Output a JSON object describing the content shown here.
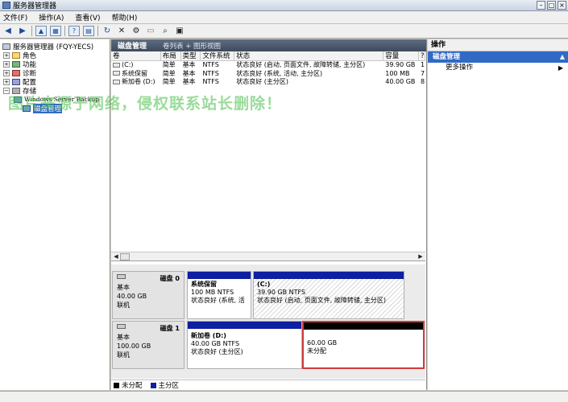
{
  "window": {
    "title": "服务器管理器",
    "controls": [
      "–",
      "□",
      "×"
    ]
  },
  "menu": {
    "items": [
      "文件(F)",
      "操作(A)",
      "查看(V)",
      "帮助(H)"
    ]
  },
  "toolbar": {
    "icons": [
      "back-icon",
      "forward-icon",
      "up-folder-icon",
      "show-tree-icon",
      "help-icon",
      "properties-icon",
      "refresh-icon",
      "delete-icon",
      "settings-icon",
      "open-icon",
      "search-icon",
      "view-icon"
    ]
  },
  "tree": {
    "root": "服务器管理器 (FQY-YECS)",
    "roles": "角色",
    "features": "功能",
    "diagnostics": "诊断",
    "configuration": "配置",
    "storage": "存储",
    "backup": "Windows Server Backup",
    "disk_mgmt": "磁盘管理"
  },
  "center": {
    "title": "磁盘管理",
    "view_links": "卷列表 + 图形视图",
    "columns": [
      "卷",
      "布局",
      "类型",
      "文件系统",
      "状态",
      "容量",
      "?"
    ],
    "rows": [
      [
        "(C:)",
        "简单",
        "基本",
        "NTFS",
        "状态良好 (启动, 页面文件, 故障转储, 主分区)",
        "39.90 GB",
        "1"
      ],
      [
        "系统保留",
        "简单",
        "基本",
        "NTFS",
        "状态良好 (系统, 活动, 主分区)",
        "100 MB",
        "7"
      ],
      [
        "新加卷 (D:)",
        "简单",
        "基本",
        "NTFS",
        "状态良好 (主分区)",
        "40.00 GB",
        "8"
      ]
    ],
    "disks": [
      {
        "name": "磁盘 0",
        "type": "基本",
        "size": "40.00 GB",
        "status": "联机",
        "partitions": [
          {
            "name": "系统保留",
            "size": "100 MB NTFS",
            "status": "状态良好 (系统, 活"
          },
          {
            "name": "(C:)",
            "size": "39.90 GB NTFS",
            "status": "状态良好 (启动, 页面文件, 故障转储, 主分区)"
          }
        ]
      },
      {
        "name": "磁盘 1",
        "type": "基本",
        "size": "100.00 GB",
        "status": "联机",
        "partitions": [
          {
            "name": "新加卷 (D:)",
            "size": "40.00 GB NTFS",
            "status": "状态良好 (主分区)"
          },
          {
            "name": "",
            "size": "60.00 GB",
            "status": "未分配"
          }
        ]
      }
    ],
    "legend": [
      {
        "label": "未分配",
        "color": "#000000"
      },
      {
        "label": "主分区",
        "color": "#0e1fa0"
      }
    ]
  },
  "actions": {
    "header": "操作",
    "section": "磁盘管理",
    "more": "更多操作"
  },
  "watermark": "图片来源于网络，侵权联系站长删除！"
}
